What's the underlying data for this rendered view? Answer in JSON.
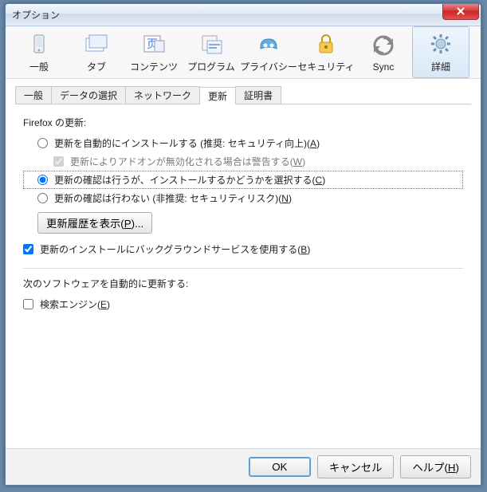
{
  "window": {
    "title": "オプション"
  },
  "toolbar": [
    {
      "id": "general",
      "label": "一般"
    },
    {
      "id": "tabs",
      "label": "タブ"
    },
    {
      "id": "content",
      "label": "コンテンツ"
    },
    {
      "id": "programs",
      "label": "プログラム"
    },
    {
      "id": "privacy",
      "label": "プライバシー"
    },
    {
      "id": "security",
      "label": "セキュリティ"
    },
    {
      "id": "sync",
      "label": "Sync"
    },
    {
      "id": "advanced",
      "label": "詳細",
      "selected": true
    }
  ],
  "subtabs": [
    {
      "id": "st-general",
      "label": "一般"
    },
    {
      "id": "st-data",
      "label": "データの選択"
    },
    {
      "id": "st-network",
      "label": "ネットワーク"
    },
    {
      "id": "st-update",
      "label": "更新",
      "active": true
    },
    {
      "id": "st-cert",
      "label": "証明書"
    }
  ],
  "updates": {
    "group_title": "Firefox の更新:",
    "opt_auto": {
      "text": "更新を自動的にインストールする (推奨: セキュリティ向上)",
      "key": "A"
    },
    "opt_warn": {
      "text": "更新によりアドオンが無効化される場合は警告する",
      "key": "W",
      "checked": true,
      "disabled": true
    },
    "opt_check": {
      "text": "更新の確認は行うが、インストールするかどうかを選択する",
      "key": "C",
      "selected": true
    },
    "opt_never": {
      "text": "更新の確認は行わない (非推奨: セキュリティリスク)",
      "key": "N"
    },
    "history_btn": {
      "text": "更新履歴を表示",
      "key": "P",
      "suffix": "..."
    },
    "opt_bgsvc": {
      "text": "更新のインストールにバックグラウンドサービスを使用する",
      "key": "B",
      "checked": true
    },
    "group2_title": "次のソフトウェアを自動的に更新する:",
    "opt_search": {
      "text": "検索エンジン",
      "key": "E",
      "checked": false
    }
  },
  "footer": {
    "ok": "OK",
    "cancel": "キャンセル",
    "help": {
      "text": "ヘルプ",
      "key": "H"
    }
  }
}
